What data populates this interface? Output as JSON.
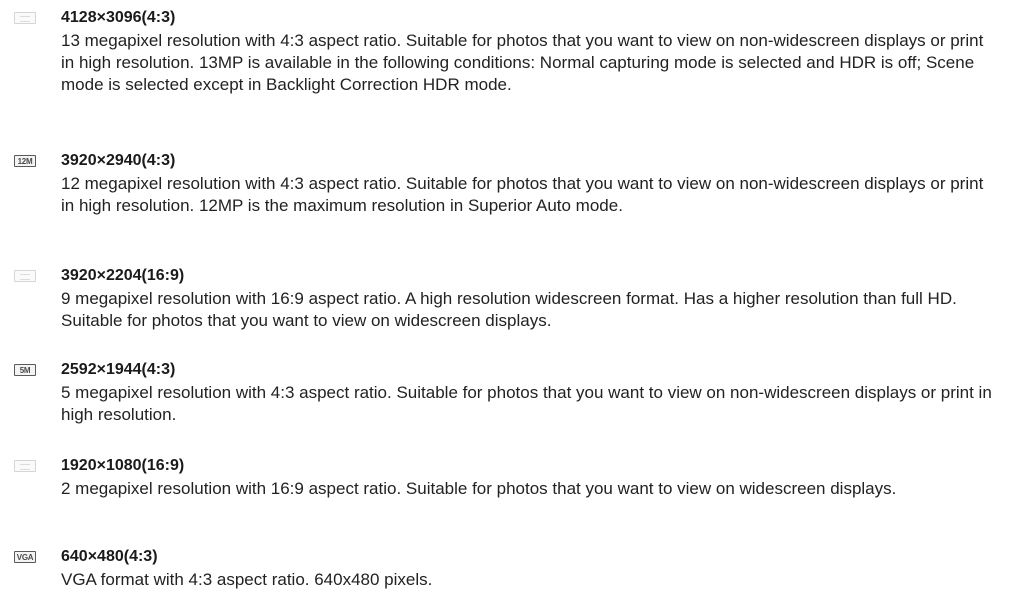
{
  "entries": [
    {
      "badge_style": "light",
      "badge_text": "",
      "heading": "4128×3096(4:3)",
      "description": "13 megapixel resolution with 4:3 aspect ratio. Suitable for photos that you want to view on non-widescreen displays or print in high resolution. 13MP is available in the following conditions: Normal capturing mode is selected and HDR is off; Scene mode is selected except in Backlight Correction HDR mode."
    },
    {
      "badge_style": "dark",
      "badge_text": "12M",
      "heading": "3920×2940(4:3)",
      "description": "12 megapixel resolution with 4:3 aspect ratio. Suitable for photos that you want to view on non-widescreen displays or print in high resolution. 12MP is the maximum resolution in Superior Auto mode."
    },
    {
      "badge_style": "light",
      "badge_text": "",
      "heading": "3920×2204(16:9)",
      "description": "9 megapixel resolution with 16:9 aspect ratio. A high resolution widescreen format. Has a higher resolution than full HD. Suitable for photos that you want to view on widescreen displays."
    },
    {
      "badge_style": "dark",
      "badge_text": "5M",
      "heading": "2592×1944(4:3)",
      "description": "5 megapixel resolution with 4:3 aspect ratio. Suitable for photos that you want to view on non-widescreen displays or print in high resolution."
    },
    {
      "badge_style": "light",
      "badge_text": "",
      "heading": "1920×1080(16:9)",
      "description": "2 megapixel resolution with 16:9 aspect ratio. Suitable for photos that you want to view on widescreen displays."
    },
    {
      "badge_style": "dark",
      "badge_text": "VGA",
      "heading": "640×480(4:3)",
      "description": "VGA format with 4:3 aspect ratio. 640x480 pixels."
    }
  ]
}
